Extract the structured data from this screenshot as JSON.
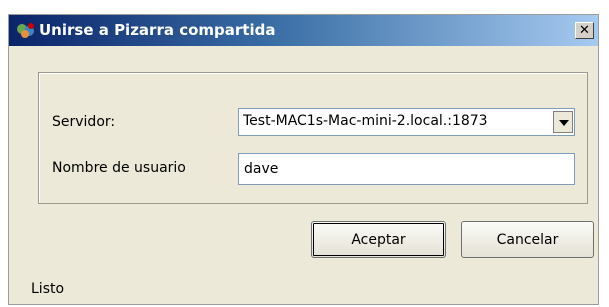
{
  "window": {
    "title": "Unirse a Pizarra compartida",
    "close_glyph": "✕"
  },
  "form": {
    "server_label": "Servidor:",
    "server_value": "Test-MAC1s-Mac-mini-2.local.:1873",
    "username_label": "Nombre de usuario",
    "username_value": "dave"
  },
  "buttons": {
    "ok_label": "Aceptar",
    "cancel_label": "Cancelar"
  },
  "status": {
    "text": "Listo"
  },
  "icons": {
    "app": "whiteboard-app-icon",
    "close": "close-icon",
    "dropdown": "chevron-down-icon"
  }
}
